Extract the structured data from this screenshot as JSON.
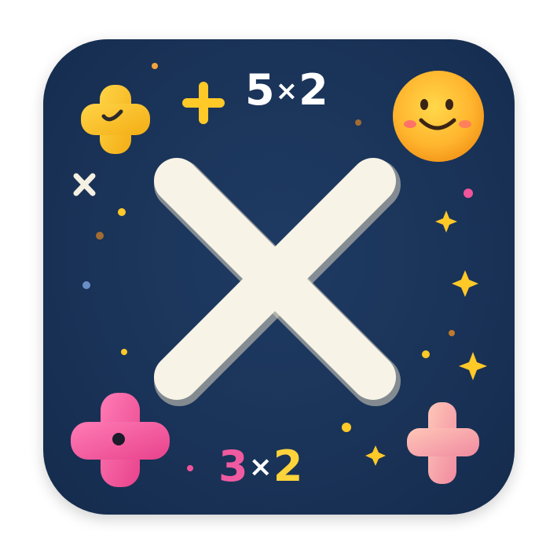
{
  "icon": {
    "top_equation": {
      "left": "5",
      "op": "×",
      "right": "2"
    },
    "bottom_equation": {
      "left": "3",
      "op": "×",
      "right": "2"
    },
    "central_symbol": "multiply-sign",
    "colors": {
      "background": "#1a3358",
      "cross": "#f7f3e6",
      "yellow": "#ffc928",
      "pink": "#f0549a",
      "peach": "#f6a6a6",
      "smiley": "#ffb833"
    }
  }
}
